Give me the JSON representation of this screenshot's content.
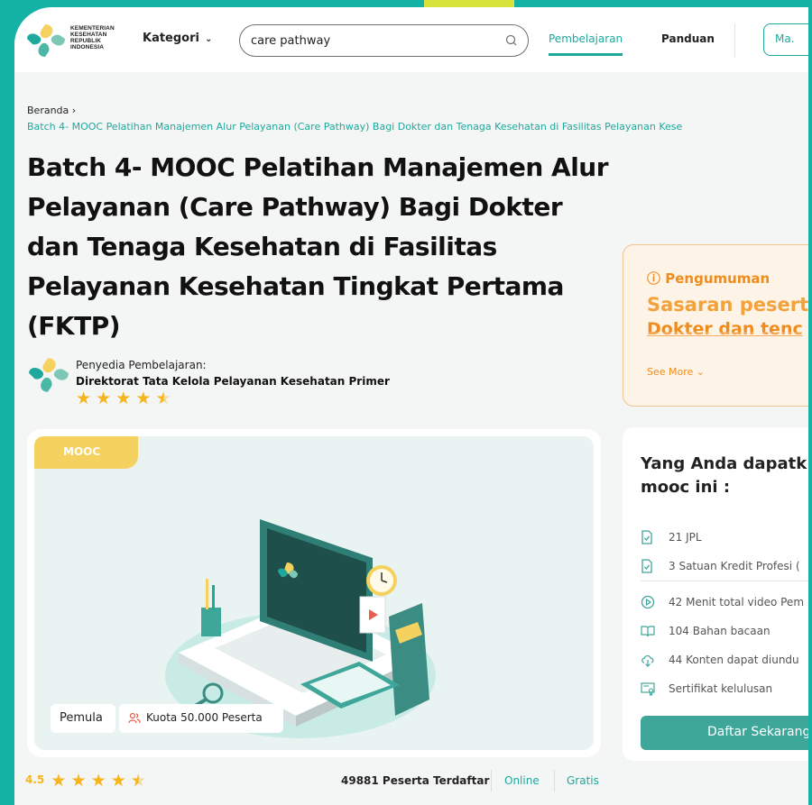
{
  "header": {
    "logo_text": [
      "KEMENTERIAN",
      "KESEHATAN",
      "REPUBLIK",
      "INDONESIA"
    ],
    "kategori_label": "Kategori",
    "search_value": "care pathway",
    "nav_pembelajaran": "Pembelajaran",
    "nav_panduan": "Panduan",
    "nav_masuk": "Ma."
  },
  "breadcrumb": {
    "home": "Beranda",
    "current": "Batch 4- MOOC Pelatihan Manajemen Alur Pelayanan (Care Pathway) Bagi Dokter dan Tenaga Kesehatan di Fasilitas Pelayanan Kese"
  },
  "course": {
    "title": "Batch 4- MOOC Pelatihan Manajemen Alur Pelayanan (Care Pathway) Bagi Dokter dan Tenaga Kesehatan di Fasilitas Pelayanan Kesehatan Tingkat Pertama (FKTP)",
    "provider_label": "Penyedia Pembelajaran:",
    "provider_name": "Direktorat Tata Kelola Pelayanan Kesehatan Primer",
    "provider_rating": 4.5,
    "badge": "MOOC",
    "level": "Pemula",
    "quota": "Kuota 50.000 Peserta",
    "rating": "4.5",
    "participants": "49881 Peserta Terdaftar",
    "mode": "Online",
    "price": "Gratis"
  },
  "announcement": {
    "title": "Pengumuman",
    "line1": "Sasaran pesertc",
    "line2": "Dokter dan tenc",
    "see_more": "See More"
  },
  "benefits": {
    "title_line1": "Yang Anda dapatk",
    "title_line2": "mooc ini :",
    "items": [
      {
        "icon": "document-check-icon",
        "text": "21 JPL"
      },
      {
        "icon": "document-check-icon",
        "text": "3 Satuan Kredit Profesi ("
      },
      {
        "icon": "play-circle-icon",
        "text": "42 Menit total video Pem"
      },
      {
        "icon": "book-open-icon",
        "text": "104 Bahan bacaan"
      },
      {
        "icon": "download-cloud-icon",
        "text": "44 Konten dapat diundu"
      },
      {
        "icon": "certificate-icon",
        "text": "Sertifikat kelulusan"
      }
    ],
    "cta": "Daftar Sekarang"
  },
  "colors": {
    "primary": "#1ea99c",
    "accent_orange": "#f08c1c",
    "star": "#f6b51a",
    "badge_yellow": "#f5d25f"
  }
}
